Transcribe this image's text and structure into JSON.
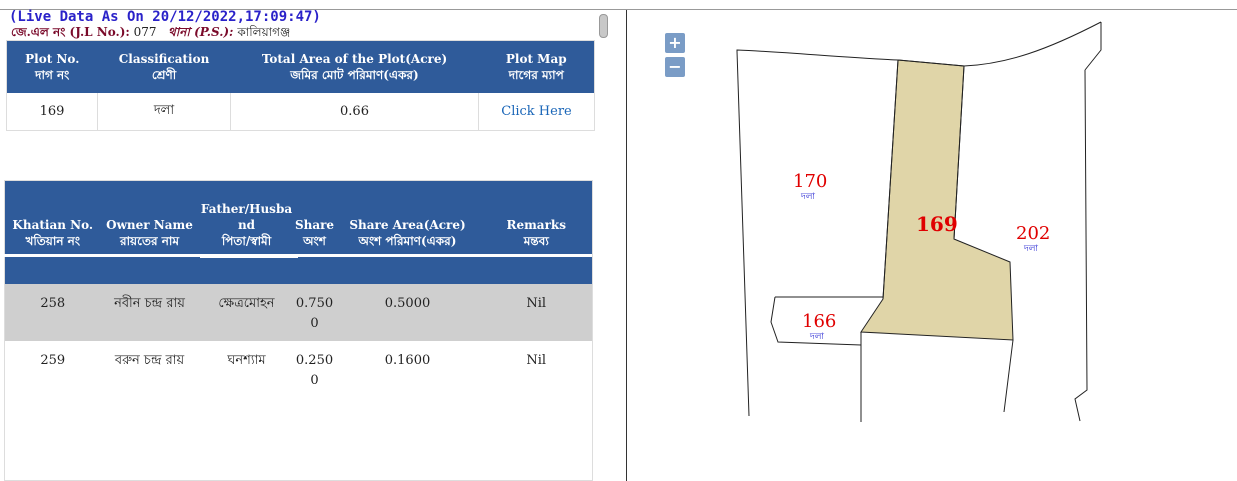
{
  "header": {
    "live_data": "(Live Data As On 20/12/2022,17:09:47)",
    "jl_label": "জে.এল নং (J.L No.):",
    "jl_value": "077",
    "ps_label": "থানা (P.S.):",
    "ps_value": "কালিয়াগঞ্জ"
  },
  "plot_table": {
    "headers": [
      {
        "line1": "Plot No.",
        "line2": "দাগ নং"
      },
      {
        "line1": "Classification",
        "line2": "শ্রেণী"
      },
      {
        "line1": "Total Area of the Plot(Acre)",
        "line2": "জমির মোট পরিমাণ(একর)"
      },
      {
        "line1": "Plot Map",
        "line2": "দাগের ম্যাপ"
      }
    ],
    "row": {
      "plot_no": "169",
      "classification": "দলা",
      "area": "0.66",
      "map_link": "Click Here"
    }
  },
  "owner_table": {
    "headers": [
      {
        "line1": "Khatian No.",
        "line2": "খতিয়ান নং"
      },
      {
        "line1": "Owner Name",
        "line2": "রায়তের নাম"
      },
      {
        "line1": "Father/Husba",
        "line1b": "nd",
        "line2": "পিতা/স্বামী"
      },
      {
        "line1": "Share",
        "line2": "অংশ"
      },
      {
        "line1": "Share Area(Acre)",
        "line2": "অংশ পরিমাণ(একর)"
      },
      {
        "line1": "Remarks",
        "line2": "মন্তব্য"
      }
    ],
    "rows": [
      {
        "khatian": "258",
        "owner": "নবীন চন্দ্র রায়",
        "father": "ক্ষেত্রমোহন",
        "share_a": "0.750",
        "share_b": "0",
        "share_area": "0.5000",
        "remarks": "Nil"
      },
      {
        "khatian": "259",
        "owner": "বরুন চন্দ্র রায়",
        "father": "ঘনশ্যাম",
        "share_a": "0.250",
        "share_b": "0",
        "share_area": "0.1600",
        "remarks": "Nil"
      }
    ]
  },
  "map": {
    "zoom_in": "+",
    "zoom_out": "−",
    "selected_fill": "#e0d5a8",
    "plots": [
      {
        "number": "170",
        "class": "দলা"
      },
      {
        "number": "169",
        "class": ""
      },
      {
        "number": "202",
        "class": "দলা"
      },
      {
        "number": "166",
        "class": "দলা"
      }
    ]
  },
  "colors": {
    "header_bg": "#2f5b9a",
    "live_text": "#2a22c9",
    "label_text": "#7a0a2a",
    "plot_label": "#e00000",
    "class_label": "#1a1ad0"
  }
}
